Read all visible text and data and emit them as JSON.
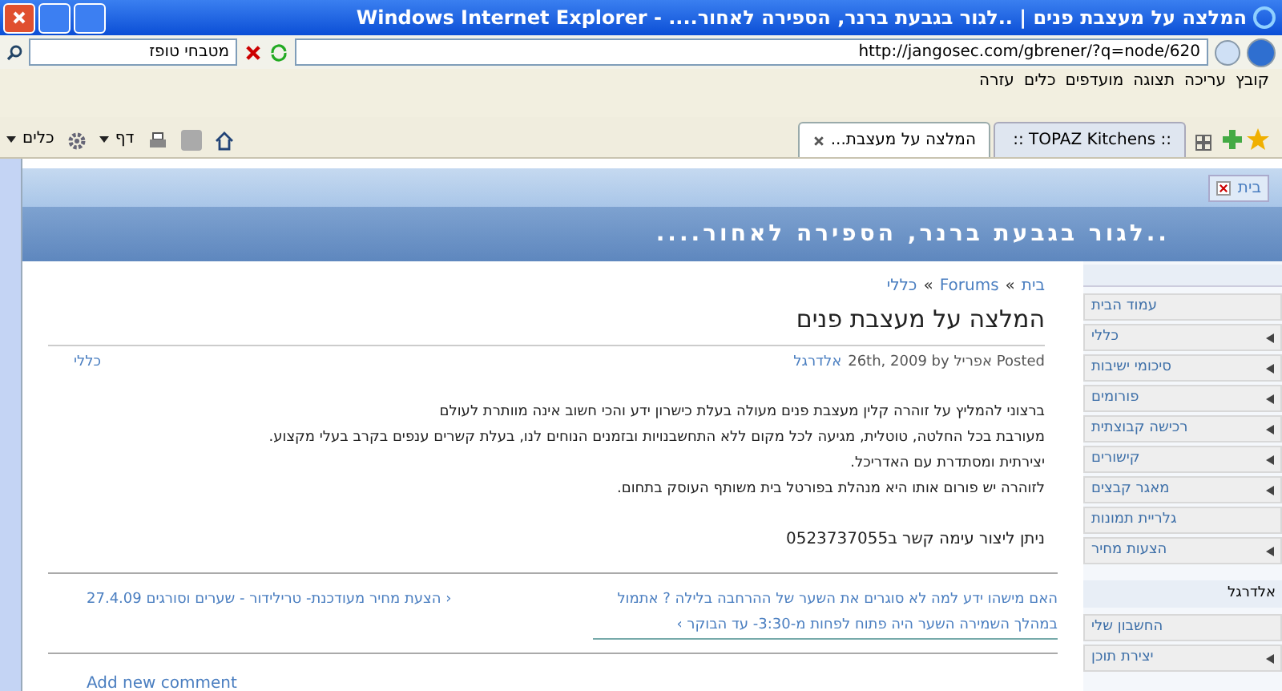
{
  "window": {
    "title": "המלצה על מעצבת פנים | ..לגור בגבעת ברנר, הספירה לאחור.... - Windows Internet Explorer"
  },
  "address": {
    "url": "http://jangosec.com/gbrener/?q=node/620"
  },
  "search": {
    "value": "מטבחי טופז"
  },
  "menu": [
    "קובץ",
    "עריכה",
    "תצוגה",
    "מועדפים",
    "כלים",
    "עזרה"
  ],
  "tabs": [
    {
      "label": ":: TOPAZ Kitchens ::",
      "selected": false
    },
    {
      "label": "המלצה על מעצבת...",
      "selected": true
    }
  ],
  "toolbar": {
    "page": "דף",
    "tools": "כלים"
  },
  "site": {
    "home_tab": "בית",
    "title": "..לגור בגבעת ברנר, הספירה לאחור...."
  },
  "breadcrumb": [
    "בית",
    "Forums",
    "כללי"
  ],
  "breadcrumb_separator": "»",
  "post": {
    "title": "המלצה על מעצבת פנים",
    "meta": "Posted אפריל 26th, 2009 by",
    "author": "אלדרגל",
    "category": "כללי",
    "paragraphs": [
      "ברצוני להמליץ על זוהרה קלין מעצבת פנים מעולה בעלת כישרון ידע והכי חשוב אינה מוותרת לעולם",
      "מעורבת בכל החלטה, טוטלית, מגיעה לכל מקום ללא התחשבנויות ובזמנים הנוחים לנו, בעלת קשרים ענפים בקרב בעלי מקצוע.",
      "יצירתית ומסתדרת עם האדריכל.",
      "לזוהרה יש פורום אותו היא מנהלת בפורטל בית משותף העוסק בתחום."
    ],
    "contact": "ניתן ליצור עימה קשר ב0523737055",
    "next": "האם מישהו ידע למה לא סוגרים את השער של ההרחבה בלילה ? אתמול במהלך השמירה השער היה פתוח לפחות מ-3:30- עד הבוקר ›",
    "prev": "‹ הצעת מחיר מעודכנת- טרילידור - שערים וסורגים 27.4.09",
    "add_comment": "Add new comment"
  },
  "sidebar": {
    "items": [
      {
        "label": "עמוד הבית",
        "expandable": false
      },
      {
        "label": "כללי",
        "expandable": true
      },
      {
        "label": "סיכומי ישיבות",
        "expandable": true
      },
      {
        "label": "פורומים",
        "expandable": true
      },
      {
        "label": "רכישה קבוצתית",
        "expandable": true
      },
      {
        "label": "קישורים",
        "expandable": true
      },
      {
        "label": "מאגר קבצים",
        "expandable": true
      },
      {
        "label": "גלריית תמונות",
        "expandable": false
      },
      {
        "label": "הצעות מחיר",
        "expandable": true
      }
    ],
    "user_title": "אלדרגל",
    "user_items": [
      {
        "label": "החשבון שלי",
        "expandable": false
      },
      {
        "label": "יצירת תוכן",
        "expandable": true
      }
    ]
  }
}
